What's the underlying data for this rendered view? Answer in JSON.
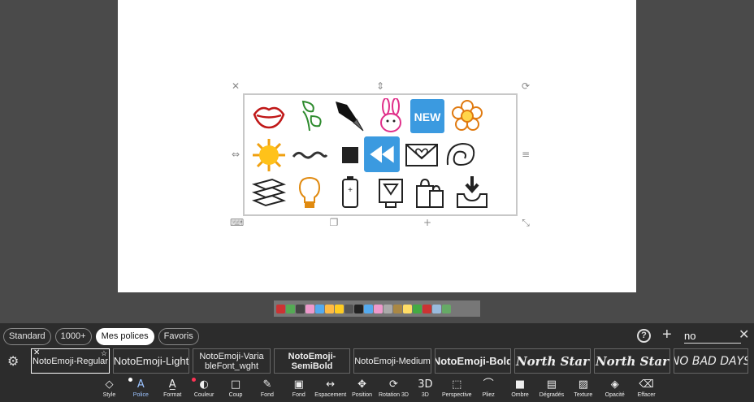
{
  "categories": [
    {
      "label": "Standard",
      "active": false
    },
    {
      "label": "1000+",
      "active": false
    },
    {
      "label": "Mes polices",
      "active": true
    },
    {
      "label": "Favoris",
      "active": false
    }
  ],
  "search": {
    "value": "no"
  },
  "fonts": [
    {
      "label": "NotoEmoji-Regular",
      "width": 97
    },
    {
      "label": "NotoEmoji-Light",
      "width": 94
    },
    {
      "label": "NotoEmoji-Varia\nbleFont_wght",
      "width": 96
    },
    {
      "label": "NotoEmoji-\nSemiBold",
      "width": 94
    },
    {
      "label": "NotoEmoji-Medium",
      "width": 96
    },
    {
      "label": "NotoEmoji-Bold",
      "width": 94
    },
    {
      "label": "North Star",
      "width": 94
    },
    {
      "label": "North Star",
      "width": 94
    },
    {
      "label": "NO BAD DAYS",
      "width": 92
    }
  ],
  "toolbar": [
    {
      "label": "Style",
      "icon": "style-icon",
      "glyph": "◇"
    },
    {
      "label": "Police",
      "icon": "font-icon",
      "glyph": "A",
      "active": true,
      "dot": "#ffffff"
    },
    {
      "label": "Format",
      "icon": "format-icon",
      "glyph": "A̲"
    },
    {
      "label": "Couleur",
      "icon": "palette-icon",
      "glyph": "◐",
      "dot": "#ff3355"
    },
    {
      "label": "Coup",
      "icon": "stroke-icon",
      "glyph": "□"
    },
    {
      "label": "Fond",
      "icon": "brush-icon",
      "glyph": "✎"
    },
    {
      "label": "Fond",
      "icon": "background-icon",
      "glyph": "▣"
    },
    {
      "label": "Espacement",
      "icon": "spacing-icon",
      "glyph": "↔"
    },
    {
      "label": "Position",
      "icon": "move-icon",
      "glyph": "✥"
    },
    {
      "label": "Rotation 3D",
      "icon": "rotate-3d-icon",
      "glyph": "⟳"
    },
    {
      "label": "3D",
      "icon": "3d-icon",
      "glyph": "3D"
    },
    {
      "label": "Perspective",
      "icon": "perspective-icon",
      "glyph": "⬚"
    },
    {
      "label": "Pliez",
      "icon": "bend-icon",
      "glyph": "⌒"
    },
    {
      "label": "Ombre",
      "icon": "shadow-icon",
      "glyph": "■"
    },
    {
      "label": "Dégradés",
      "icon": "gradient-icon",
      "glyph": "▤"
    },
    {
      "label": "Texture",
      "icon": "texture-icon",
      "glyph": "▨"
    },
    {
      "label": "Opacité",
      "icon": "opacity-icon",
      "glyph": "◈"
    },
    {
      "label": "Effacer",
      "icon": "eraser-icon",
      "glyph": "⌫"
    }
  ],
  "emojis": [
    "lips",
    "leaf",
    "fountain-pen",
    "rabbit-face",
    "new-button",
    "blossom",
    "sun",
    "wavy-dash",
    "black-square",
    "rewind-button",
    "love-letter",
    "spiral-shell",
    "books",
    "light-bulb",
    "battery",
    "ballot-box",
    "shopping-bags",
    "inbox-tray"
  ],
  "colors": {
    "accent": "#9cc3ff",
    "panel": "#2c2c2c",
    "workspace": "#4a4a4a"
  }
}
